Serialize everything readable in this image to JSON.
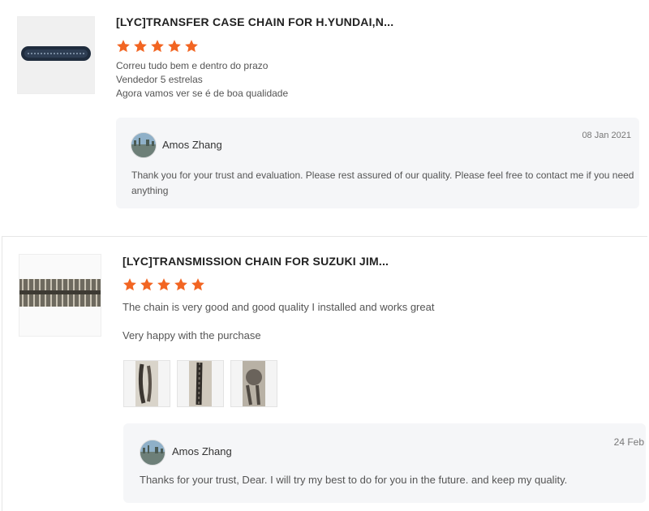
{
  "reviews": [
    {
      "product_title": "[LYC]TRANSFER CASE CHAIN FOR H.YUNDAI,N...",
      "rating": 5,
      "comment_lines": [
        "Correu tudo bem e dentro do prazo",
        "Vendedor 5 estrelas",
        "Agora vamos ver se é de boa qualidade"
      ],
      "reply": {
        "author": "Amos Zhang",
        "date": "08 Jan 2021",
        "text": "Thank you for your trust and evaluation. Please rest assured of our quality. Please feel free to contact me if you need anything"
      }
    },
    {
      "product_title": "[LYC]TRANSMISSION CHAIN FOR SUZUKI JIM...",
      "rating": 5,
      "comment_lines": [
        "The chain is very good and good quality I installed and works great",
        "Very happy with the purchase"
      ],
      "photos": [
        "review-photo-1",
        "review-photo-2",
        "review-photo-3"
      ],
      "reply": {
        "author": "Amos Zhang",
        "date": "24 Feb",
        "text": "Thanks for your trust, Dear. I will try my best to do for you in the future. and keep my quality."
      }
    }
  ],
  "colors": {
    "star": "#f26522",
    "reply_bg": "#f5f6f8"
  },
  "icons": {
    "star": "star-icon",
    "avatar": "avatar-image"
  }
}
